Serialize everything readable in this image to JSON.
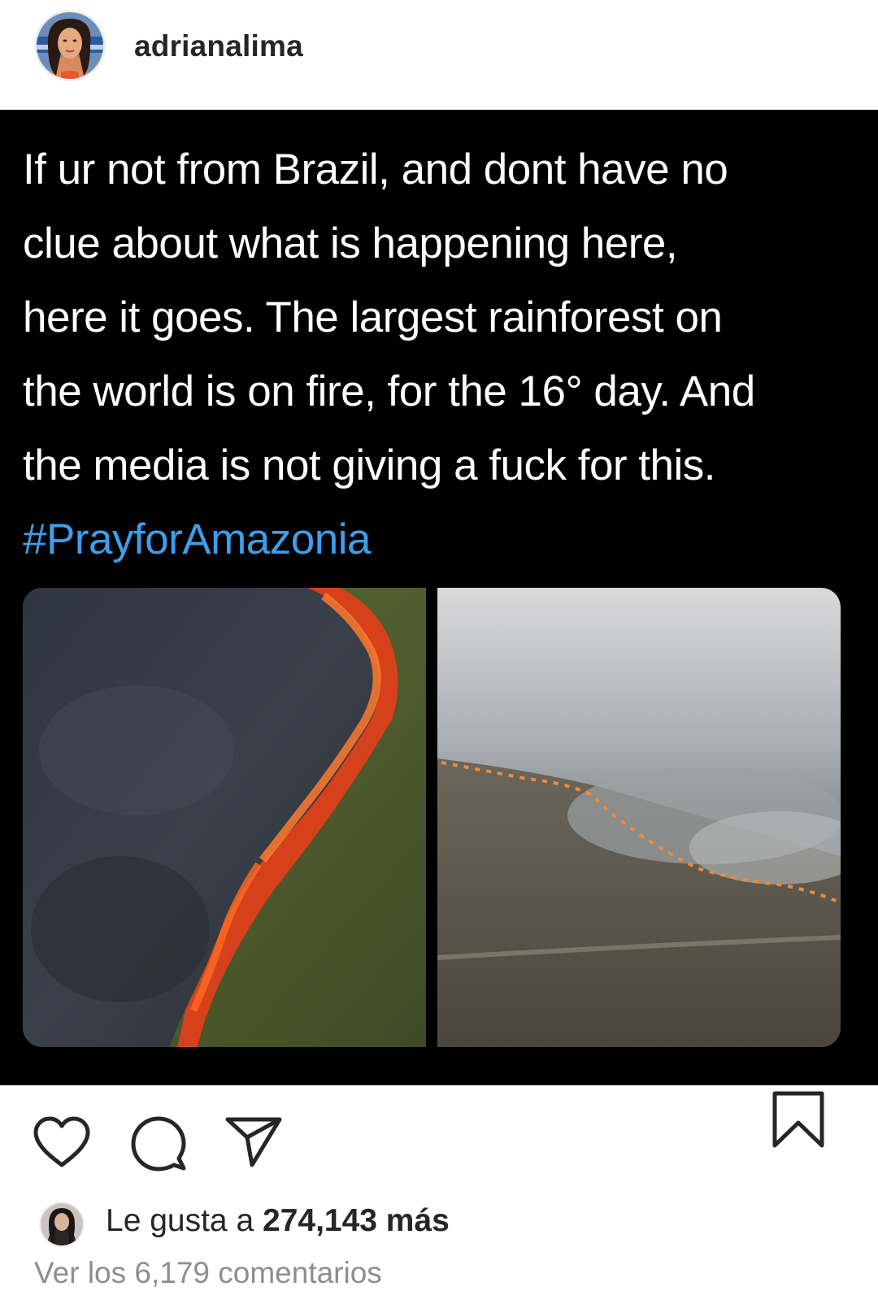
{
  "header": {
    "username": "adrianalima",
    "avatar_icon": "profile-photo"
  },
  "post": {
    "tweet_lines": [
      "If ur not from Brazil, and dont have no",
      "clue about what is happening here,",
      "here it goes. The largest rainforest on",
      "the world is on fire, for the 16° day. And",
      "the media is not giving a fuck for this."
    ],
    "hashtag": "#PrayforAmazonia",
    "images": [
      {
        "icon": "fire-front-aerial-photo"
      },
      {
        "icon": "smoke-over-forest-photo"
      }
    ]
  },
  "actions": {
    "like_icon": "heart-icon",
    "comment_icon": "comment-icon",
    "share_icon": "send-icon",
    "save_icon": "bookmark-icon"
  },
  "likes": {
    "prefix": "Le gusta a",
    "count_text": "274,143 más"
  },
  "comments": {
    "link_text": "Ver los 6,179 comentarios"
  },
  "colors": {
    "hashtag": "#3c9fea",
    "post_background": "#000000",
    "muted_text": "#8e8e8e"
  }
}
